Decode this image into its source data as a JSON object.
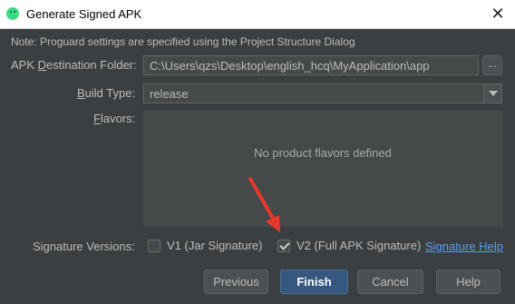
{
  "window": {
    "title": "Generate Signed APK",
    "close_icon": "close-icon"
  },
  "note": "Note: Proguard settings are specified using the Project Structure Dialog",
  "destination": {
    "label_pre": "APK ",
    "label_u": "D",
    "label_post": "estination Folder:",
    "value": "C:\\Users\\qzs\\Desktop\\english_hcq\\MyApplication\\app",
    "browse_label": "..."
  },
  "build_type": {
    "label_pre": "",
    "label_u": "B",
    "label_post": "uild Type:",
    "value": "release"
  },
  "flavors": {
    "label_pre": "",
    "label_u": "F",
    "label_post": "lavors:",
    "empty_text": "No product flavors defined"
  },
  "signature": {
    "label": "Signature Versions:",
    "v1": {
      "label": "V1 (Jar Signature)",
      "checked": false
    },
    "v2": {
      "label": "V2 (Full APK Signature)",
      "checked": true
    },
    "help_link": "Signature Help"
  },
  "buttons": {
    "previous": "Previous",
    "finish": "Finish",
    "cancel": "Cancel",
    "help": "Help"
  },
  "colors": {
    "background": "#3c3f41",
    "accent_button": "#365880",
    "link": "#589df6",
    "annotation_arrow": "#e8382c"
  }
}
